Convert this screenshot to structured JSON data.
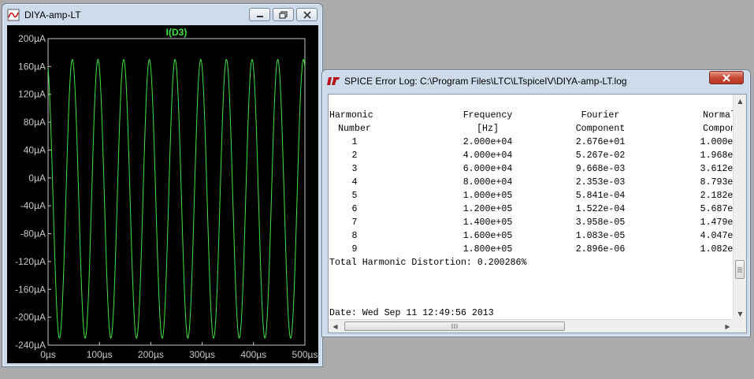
{
  "wave_window": {
    "title": "DIYA-amp-LT",
    "trace_label": "I(D3)",
    "buttons": [
      "minimize",
      "maximize",
      "close"
    ]
  },
  "chart_data": {
    "type": "line",
    "title": "",
    "series": [
      {
        "name": "I(D3)",
        "color": "#3ee63e",
        "description_values": {
          "frequency_hz": 20000,
          "max_uA": 170,
          "min_uA": -230,
          "t_start_us": 0,
          "t_end_us": 500
        }
      }
    ],
    "xlim": [
      0,
      500
    ],
    "ylim": [
      -240,
      200
    ],
    "x_ticks": [
      "0µs",
      "100µs",
      "200µs",
      "300µs",
      "400µs",
      "500µs"
    ],
    "y_ticks": [
      "200µA",
      "160µA",
      "120µA",
      "80µA",
      "40µA",
      "0µA",
      "-40µA",
      "-80µA",
      "-120µA",
      "-160µA",
      "-200µA",
      "-240µA"
    ],
    "grid": false
  },
  "log_window": {
    "title": "SPICE Error Log: C:\\Program Files\\LTC\\LTspiceIV\\DIYA-amp-LT.log",
    "header1": [
      "Harmonic",
      "Frequency",
      "Fourier",
      "Normal"
    ],
    "header2": [
      "Number",
      "[Hz]",
      "Component",
      "Compon"
    ],
    "rows": [
      [
        "1",
        "2.000e+04",
        "2.676e+01",
        "1.000e-"
      ],
      [
        "2",
        "4.000e+04",
        "5.267e-02",
        "1.968e-"
      ],
      [
        "3",
        "6.000e+04",
        "9.668e-03",
        "3.612e-"
      ],
      [
        "4",
        "8.000e+04",
        "2.353e-03",
        "8.793e-"
      ],
      [
        "5",
        "1.000e+05",
        "5.841e-04",
        "2.182e-"
      ],
      [
        "6",
        "1.200e+05",
        "1.522e-04",
        "5.687e-"
      ],
      [
        "7",
        "1.400e+05",
        "3.958e-05",
        "1.479e-"
      ],
      [
        "8",
        "1.600e+05",
        "1.083e-05",
        "4.047e-"
      ],
      [
        "9",
        "1.800e+05",
        "2.896e-06",
        "1.082e-"
      ]
    ],
    "thd": "Total Harmonic Distortion: 0.200286%",
    "date": "Date: Wed Sep 11 12:49:56 2013"
  },
  "colors": {
    "plot_bg": "#000000",
    "axis": "#c8c8c8",
    "trace": "#3ee63e",
    "desktop": "#ababab"
  }
}
